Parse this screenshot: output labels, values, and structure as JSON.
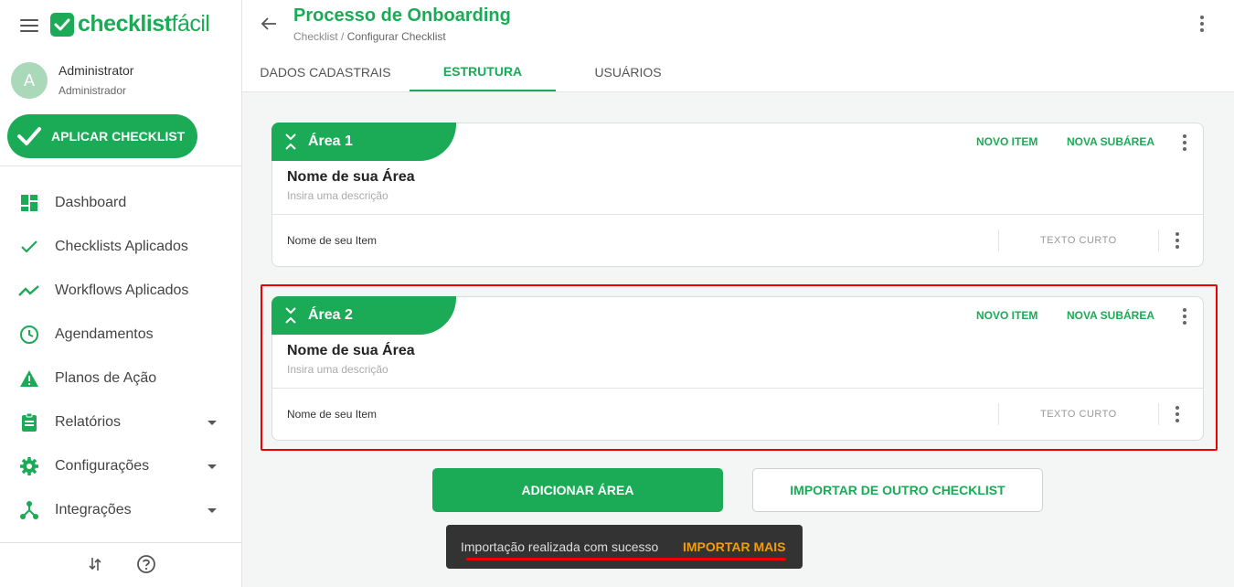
{
  "sidebar": {
    "logo": {
      "bold": "checklist",
      "light": "fácil"
    },
    "user": {
      "initial": "A",
      "name": "Administrator",
      "role": "Administrador"
    },
    "apply_button": "APLICAR CHECKLIST",
    "nav": [
      {
        "label": "Dashboard",
        "icon": "dashboard-icon",
        "has_caret": false
      },
      {
        "label": "Checklists Aplicados",
        "icon": "check-icon",
        "has_caret": false
      },
      {
        "label": "Workflows Aplicados",
        "icon": "trending-icon",
        "has_caret": false
      },
      {
        "label": "Agendamentos",
        "icon": "clock-icon",
        "has_caret": false
      },
      {
        "label": "Planos de Ação",
        "icon": "warning-icon",
        "has_caret": false
      },
      {
        "label": "Relatórios",
        "icon": "clipboard-icon",
        "has_caret": true
      },
      {
        "label": "Configurações",
        "icon": "gear-icon",
        "has_caret": true
      },
      {
        "label": "Integrações",
        "icon": "hub-icon",
        "has_caret": true
      }
    ],
    "footer_icons": [
      "sort-arrows-icon",
      "help-icon"
    ]
  },
  "header": {
    "title": "Processo de Onboarding",
    "breadcrumb": {
      "parent": "Checklist",
      "separator": " / ",
      "current": "Configurar Checklist"
    },
    "tabs": [
      {
        "label": "DADOS CADASTRAIS",
        "active": false
      },
      {
        "label": "ESTRUTURA",
        "active": true
      },
      {
        "label": "USUÁRIOS",
        "active": false
      }
    ]
  },
  "areas": [
    {
      "label": "Área 1",
      "actions": {
        "new_item": "NOVO ITEM",
        "new_subarea": "NOVA SUBÁREA"
      },
      "name": "Nome de sua Área",
      "description_placeholder": "Insira uma descrição",
      "item": {
        "name": "Nome de seu Item",
        "type": "TEXTO  CURTO"
      }
    },
    {
      "label": "Área 2",
      "actions": {
        "new_item": "NOVO ITEM",
        "new_subarea": "NOVA SUBÁREA"
      },
      "name": "Nome de sua Área",
      "description_placeholder": "Insira uma descrição",
      "item": {
        "name": "Nome de seu Item",
        "type": "TEXTO  CURTO"
      }
    }
  ],
  "buttons": {
    "add_area": "ADICIONAR ÁREA",
    "import": "IMPORTAR DE OUTRO CHECKLIST"
  },
  "snackbar": {
    "message": "Importação realizada com sucesso",
    "action": "IMPORTAR MAIS"
  },
  "colors": {
    "brand": "#1bab56",
    "highlight": "#ee0000",
    "snack_action": "#f39c12"
  }
}
